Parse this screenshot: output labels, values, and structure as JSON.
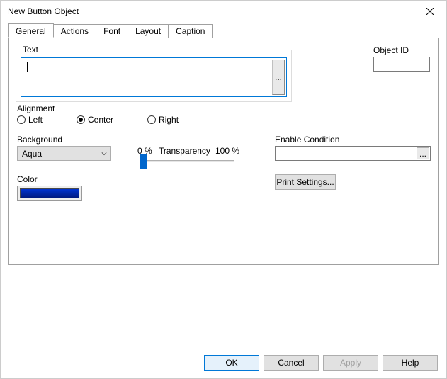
{
  "window": {
    "title": "New Button Object"
  },
  "tabs": [
    "General",
    "Actions",
    "Font",
    "Layout",
    "Caption"
  ],
  "activeTab": 0,
  "textGroup": {
    "legend": "Text",
    "value": "",
    "ellipsis": "..."
  },
  "objectId": {
    "label": "Object ID",
    "value": ""
  },
  "alignment": {
    "label": "Alignment",
    "options": [
      "Left",
      "Center",
      "Right"
    ],
    "selected": "Center"
  },
  "background": {
    "label": "Background",
    "selected": "Aqua"
  },
  "transparency": {
    "label": "Transparency",
    "minLabel": "0 %",
    "maxLabel": "100 %",
    "value": 0
  },
  "color": {
    "label": "Color",
    "value": "#0526B0"
  },
  "enableCondition": {
    "label": "Enable Condition",
    "value": "",
    "ellipsis": "..."
  },
  "printSettings": {
    "label": "Print Settings..."
  },
  "footer": {
    "ok": "OK",
    "cancel": "Cancel",
    "apply": "Apply",
    "help": "Help"
  }
}
